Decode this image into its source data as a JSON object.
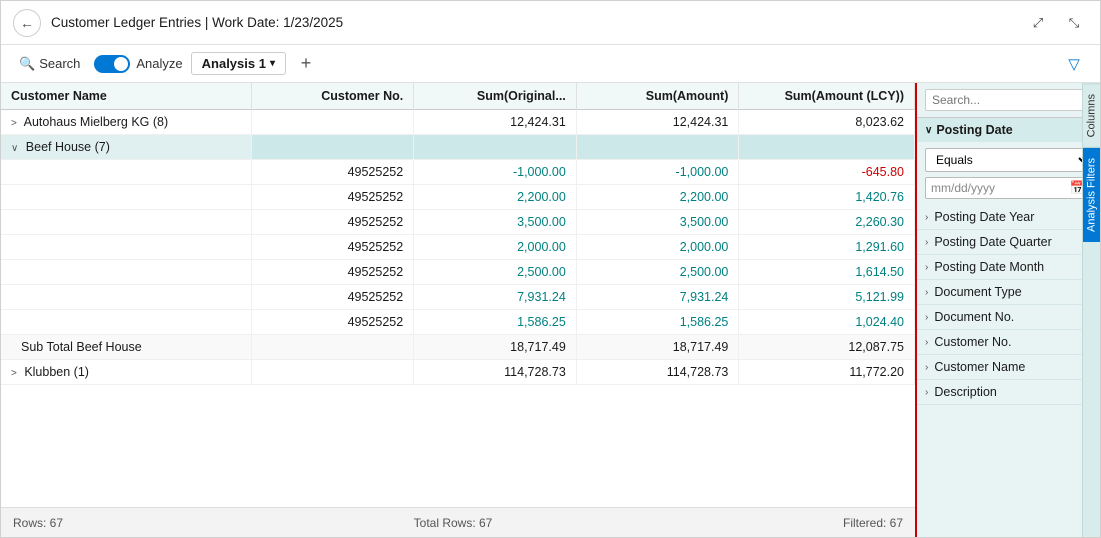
{
  "header": {
    "title": "Customer Ledger Entries | Work Date: 1/23/2025",
    "back_label": "←",
    "expand_icon": "⤢",
    "minimize_icon": "⤡"
  },
  "toolbar": {
    "search_label": "Search",
    "analyze_label": "Analyze",
    "analysis_tab_label": "Analysis 1",
    "add_label": "+",
    "filter_icon": "▽"
  },
  "table": {
    "columns": [
      "Customer Name",
      "Customer No.",
      "Sum(Original...",
      "Sum(Amount)",
      "Sum(Amount (LCY))"
    ],
    "rows": [
      {
        "type": "group",
        "expanded": false,
        "label": "Autohaus Mielberg KG (8)",
        "customer_no": "",
        "sum_original": "12,424.31",
        "sum_amount": "12,424.31",
        "sum_amount_lcy": "8,023.62"
      },
      {
        "type": "group",
        "expanded": true,
        "label": "Beef House (7)",
        "customer_no": "",
        "sum_original": "",
        "sum_amount": "",
        "sum_amount_lcy": ""
      },
      {
        "type": "data",
        "label": "",
        "customer_no": "49525252",
        "sum_original": "-1,000.00",
        "sum_amount": "-1,000.00",
        "sum_amount_lcy": "-645.80"
      },
      {
        "type": "data",
        "label": "",
        "customer_no": "49525252",
        "sum_original": "2,200.00",
        "sum_amount": "2,200.00",
        "sum_amount_lcy": "1,420.76"
      },
      {
        "type": "data",
        "label": "",
        "customer_no": "49525252",
        "sum_original": "3,500.00",
        "sum_amount": "3,500.00",
        "sum_amount_lcy": "2,260.30"
      },
      {
        "type": "data",
        "label": "",
        "customer_no": "49525252",
        "sum_original": "2,000.00",
        "sum_amount": "2,000.00",
        "sum_amount_lcy": "1,291.60"
      },
      {
        "type": "data",
        "label": "",
        "customer_no": "49525252",
        "sum_original": "2,500.00",
        "sum_amount": "2,500.00",
        "sum_amount_lcy": "1,614.50"
      },
      {
        "type": "data",
        "label": "",
        "customer_no": "49525252",
        "sum_original": "7,931.24",
        "sum_amount": "7,931.24",
        "sum_amount_lcy": "5,121.99"
      },
      {
        "type": "data",
        "label": "",
        "customer_no": "49525252",
        "sum_original": "1,586.25",
        "sum_amount": "1,586.25",
        "sum_amount_lcy": "1,024.40"
      },
      {
        "type": "subtotal",
        "label": "Sub Total Beef House",
        "customer_no": "",
        "sum_original": "18,717.49",
        "sum_amount": "18,717.49",
        "sum_amount_lcy": "12,087.75"
      },
      {
        "type": "group",
        "expanded": false,
        "label": "Klubben (1)",
        "customer_no": "",
        "sum_original": "114,728.73",
        "sum_amount": "114,728.73",
        "sum_amount_lcy": "11,772.20"
      }
    ]
  },
  "status_bar": {
    "rows_label": "Rows: 67",
    "total_rows_label": "Total Rows: 67",
    "filtered_label": "Filtered: 67"
  },
  "filter_panel": {
    "search_placeholder": "Search...",
    "posting_date_section": "Posting Date",
    "equals_option": "Equals",
    "date_placeholder": "mm/dd/yyyy",
    "filter_items": [
      "Posting Date Year",
      "Posting Date Quarter",
      "Posting Date Month",
      "Document Type",
      "Document No.",
      "Customer No.",
      "Customer Name",
      "Description"
    ],
    "side_tabs": [
      "Columns",
      "Analysis Filters"
    ]
  }
}
